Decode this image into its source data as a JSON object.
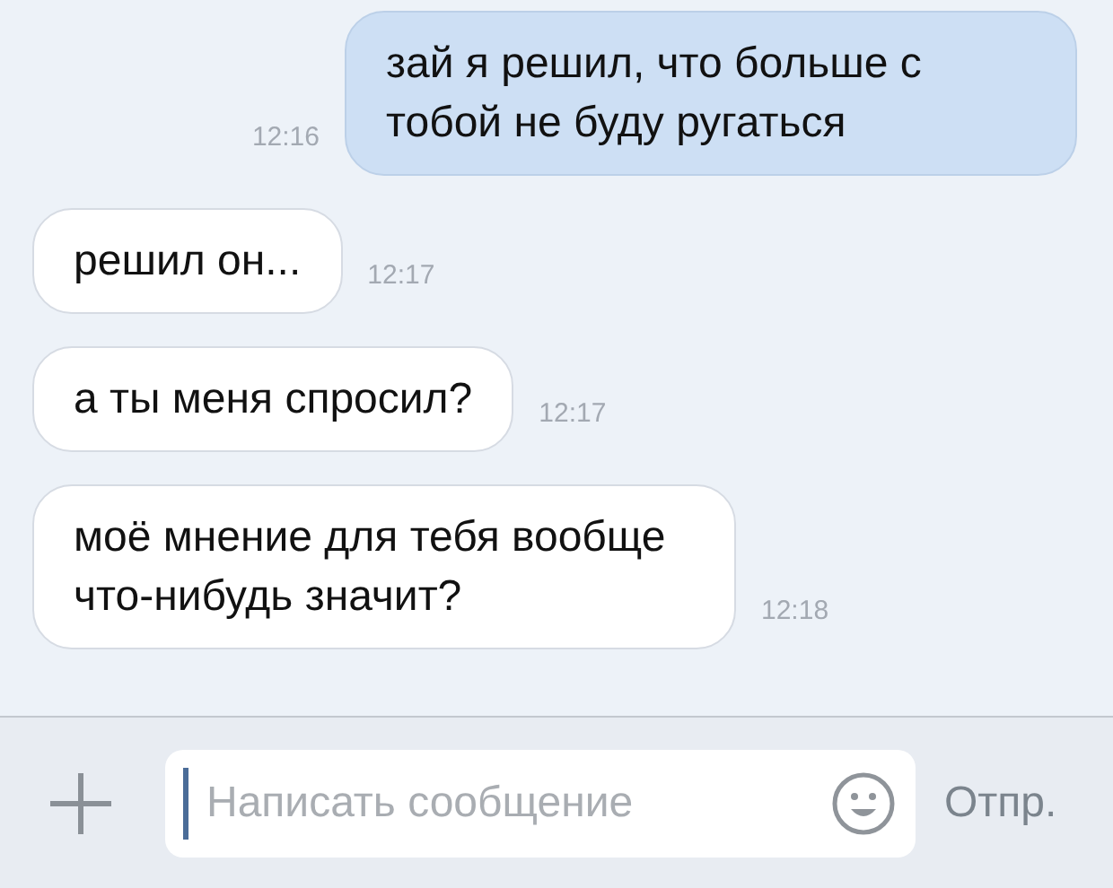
{
  "messages": [
    {
      "kind": "outgoing",
      "text": "зай я решил, что больше с тобой не буду ругаться",
      "time": "12:16"
    },
    {
      "kind": "incoming",
      "text": "решил он...",
      "time": "12:17"
    },
    {
      "kind": "incoming",
      "text": "а ты меня спросил?",
      "time": "12:17"
    },
    {
      "kind": "incoming",
      "text": "моё мнение для тебя вообще что-нибудь значит?",
      "time": "12:18"
    }
  ],
  "composer": {
    "placeholder": "Написать сообщение",
    "send": "Отпр."
  }
}
